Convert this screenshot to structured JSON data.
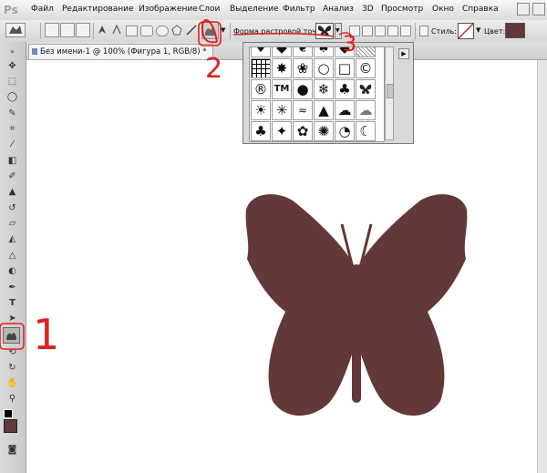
{
  "app": {
    "logo": "Ps"
  },
  "menubar": {
    "items": [
      "Файл",
      "Редактирование",
      "Изображение",
      "Слои",
      "Выделение",
      "Фильтр",
      "Анализ",
      "3D",
      "Просмотр",
      "Окно",
      "Справка"
    ]
  },
  "options_bar": {
    "shape_label": "Форма растровой точки:",
    "style_label": "Стиль:",
    "color_label": "Цвет:",
    "color_value": "#633838"
  },
  "document": {
    "tab_title": "Без имени-1 @ 100% (Фигура 1, RGB/8) *",
    "shape_fill": "#633838"
  },
  "picker": {
    "shapes": [
      [
        "heart-small",
        "diamond-dot",
        "leaf",
        "spade",
        "diamonds-cluster",
        "checker"
      ],
      [
        "grid-square",
        "starburst",
        "paw",
        "circle-outline",
        "square-outline",
        "copyright"
      ],
      [
        "registered",
        "TM",
        "bubble",
        "snowflake",
        "clover",
        "butterfly"
      ],
      [
        "sun",
        "stars",
        "waves",
        "drop",
        "cloud-fill",
        "cloud-outline"
      ],
      [
        "plant",
        "bird",
        "flower",
        "sunflower",
        "pie",
        "moon"
      ]
    ]
  },
  "annotations": [
    "1",
    "2",
    "3"
  ]
}
